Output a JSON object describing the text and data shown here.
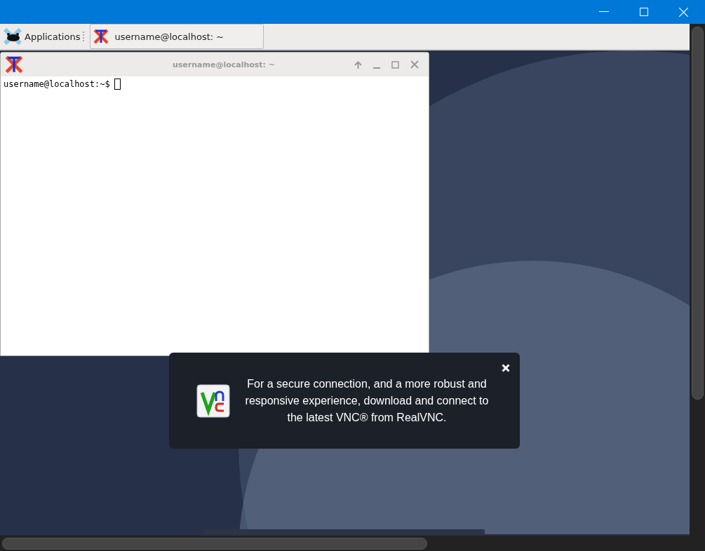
{
  "panel": {
    "menu_label": "Applications",
    "tasks": [
      {
        "label": "username@localhost: ~"
      }
    ]
  },
  "terminal": {
    "title": "username@localhost: ~",
    "prompt": "username@localhost:~$"
  },
  "notification": {
    "message": "For a secure connection, and a more robust and responsive experience, download and connect to the latest VNC® from RealVNC."
  }
}
